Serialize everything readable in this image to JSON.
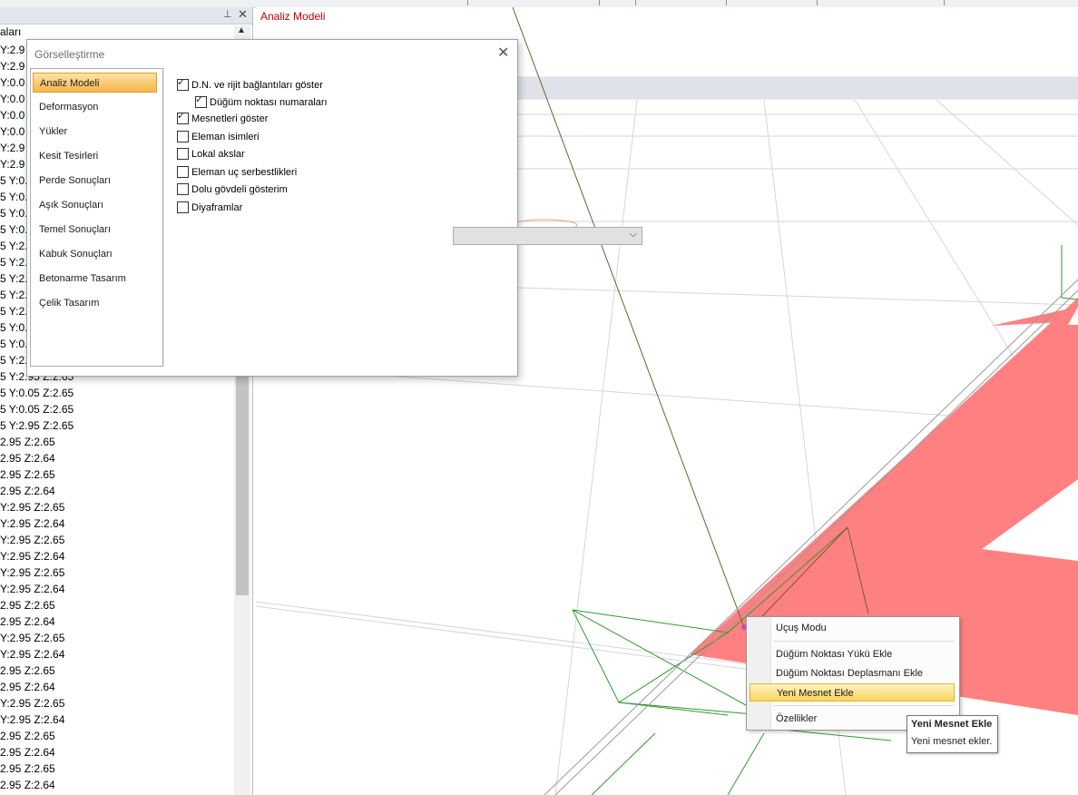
{
  "viewport": {
    "title": "Analiz Modeli"
  },
  "left_panel": {
    "pin_icon": "pin-icon",
    "close_icon": "close-icon",
    "tree_header": "aları",
    "nodes": [
      "Y:2.9",
      "Y:2.9",
      "Y:0.0",
      "Y:0.0",
      "Y:0.0",
      "Y:0.0",
      "Y:2.9",
      "Y:2.9",
      "5 Y:0.0",
      "5 Y:0.0",
      "5 Y:0.0",
      "5 Y:0.0",
      "5 Y:2.9",
      "5 Y:2.9",
      "5 Y:2.9",
      "5 Y:2.9",
      "5 Y:2.9",
      "5 Y:0.0",
      "5 Y:0.0",
      "5 Y:2.9",
      "5 Y:2.95 Z:2.65",
      "5 Y:0.05 Z:2.65",
      "5 Y:0.05 Z:2.65",
      "5 Y:2.95 Z:2.65",
      "2.95 Z:2.65",
      "2.95 Z:2.64",
      "2.95 Z:2.65",
      "2.95 Z:2.64",
      "Y:2.95 Z:2.65",
      "Y:2.95 Z:2.64",
      "Y:2.95 Z:2.65",
      "Y:2.95 Z:2.64",
      "Y:2.95 Z:2.65",
      "Y:2.95 Z:2.64",
      "2.95 Z:2.65",
      "2.95 Z:2.64",
      "Y:2.95 Z:2.65",
      "Y:2.95 Z:2.64",
      "2.95 Z:2.65",
      "2.95 Z:2.64",
      "Y:2.95 Z:2.65",
      "Y:2.95 Z:2.64",
      "2.95 Z:2.65",
      "2.95 Z:2.64",
      "2.95 Z:2.65",
      "2.95 Z:2.64"
    ]
  },
  "dialog": {
    "title": "Görselleştirme",
    "nav": [
      "Analiz Modeli",
      "Deformasyon",
      "Yükler",
      "Kesit Tesirleri",
      "Perde Sonuçları",
      "Aşık Sonuçları",
      "Temel Sonuçları",
      "Kabuk Sonuçları",
      "Betonarme Tasarım",
      "Çelik Tasarım"
    ],
    "active_nav": "Analiz Modeli",
    "options": [
      {
        "label": "D.N. ve rijit bağlantıları göster",
        "checked": true
      },
      {
        "label": "Düğüm noktası numaraları",
        "checked": true
      },
      {
        "label": "Mesnetleri göster",
        "checked": true
      },
      {
        "label": "Eleman isimleri",
        "checked": false
      },
      {
        "label": "Lokal akslar",
        "checked": false
      },
      {
        "label": "Eleman uç serbestlikleri",
        "checked": false
      },
      {
        "label": "Dolu gövdeli gösterim",
        "checked": false
      },
      {
        "label": "Diyaframlar",
        "checked": false
      }
    ],
    "diyaframlar_select_value": ""
  },
  "context_menu": {
    "items": [
      {
        "label": "Uçuş Modu"
      },
      {
        "label": "Düğüm Noktası Yükü Ekle"
      },
      {
        "label": "Düğüm Noktası Deplasmanı Ekle"
      },
      {
        "label": "Yeni Mesnet Ekle",
        "highlighted": true
      },
      {
        "label": "Özellikler"
      }
    ]
  },
  "tooltip": {
    "title": "Yeni Mesnet Ekle",
    "text": "Yeni mesnet ekler."
  },
  "colors": {
    "viewport_title": "#c00000",
    "slab_fill": "#ff8080",
    "nav_active": "#f8b54a",
    "menu_highlight": "#fbd55d",
    "frame_green": "#2e9b2e",
    "element_brown": "#7a5a30"
  }
}
